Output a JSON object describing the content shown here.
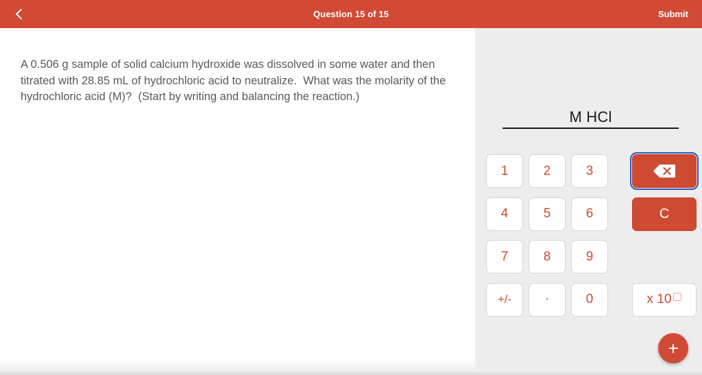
{
  "header": {
    "back_icon": "chevron-left-icon",
    "title": "Question 15 of 15",
    "submit_label": "Submit",
    "background_color": "#d04a35",
    "text_color": "#ffffff"
  },
  "question": {
    "text": "A 0.506 g sample of solid calcium hydroxide was dissolved in some water and then titrated with 28.85 mL of hydrochloric acid to neutralize.  What was the molarity of the hydrochloric acid (M)?  (Start by writing and balancing the reaction.)",
    "text_color": "#595959"
  },
  "answer": {
    "value": "",
    "unit_label": "M HCl",
    "panel_color": "#ededed"
  },
  "keypad": {
    "accent_color": "#cf4a32",
    "focus_ring_color": "#2a56c6",
    "rows": [
      {
        "keys": [
          "1",
          "2",
          "3"
        ],
        "action": {
          "name": "backspace-button",
          "icon": "backspace-icon",
          "label": "",
          "style": "red",
          "focused": true
        }
      },
      {
        "keys": [
          "4",
          "5",
          "6"
        ],
        "action": {
          "name": "clear-button",
          "icon": "",
          "label": "C",
          "style": "red",
          "focused": false
        }
      },
      {
        "keys": [
          "7",
          "8",
          "9"
        ],
        "action": null
      },
      {
        "keys": [
          "+/-",
          ".",
          "0"
        ],
        "action": {
          "name": "exponent-button",
          "icon": "",
          "label": "x 10",
          "style": "ghost",
          "focused": false,
          "has_exponent_box": true
        }
      }
    ]
  },
  "fab": {
    "icon": "plus-icon",
    "color": "#d04a35"
  }
}
